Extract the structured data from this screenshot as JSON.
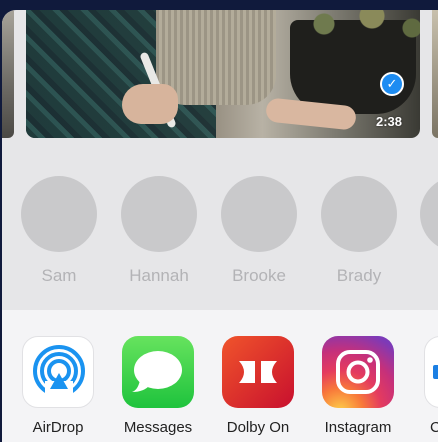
{
  "media": {
    "duration": "2:38",
    "selected_icon": "checkmark-icon"
  },
  "people": [
    {
      "name": "Sam"
    },
    {
      "name": "Hannah"
    },
    {
      "name": "Brooke"
    },
    {
      "name": "Brady"
    }
  ],
  "apps": [
    {
      "label": "AirDrop",
      "icon": "airdrop-icon"
    },
    {
      "label": "Messages",
      "icon": "messages-icon"
    },
    {
      "label": "Dolby On",
      "icon": "dolby-on-icon"
    },
    {
      "label": "Instagram",
      "icon": "instagram-icon"
    },
    {
      "label": "C",
      "icon": "partial-app-icon"
    }
  ],
  "colors": {
    "accent": "#1d8cf2",
    "sheet_background": "#e6e6e8",
    "backdrop": "#101a3c"
  }
}
